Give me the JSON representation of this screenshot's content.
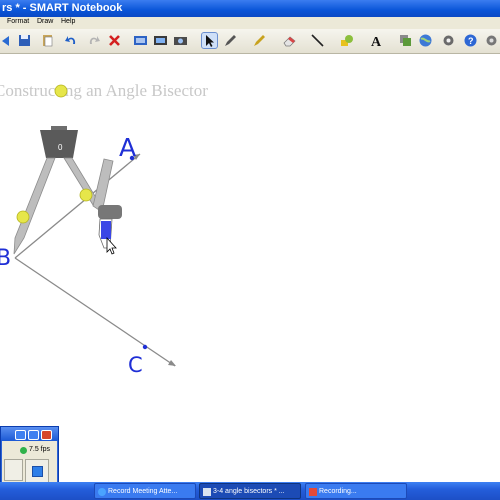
{
  "window": {
    "title": "rs * - SMART Notebook"
  },
  "menu": {
    "items": [
      "Format",
      "Draw",
      "Help"
    ]
  },
  "canvas": {
    "title": "Constructing an Angle Bisector",
    "points": {
      "a": "A",
      "b": "B",
      "c": "C"
    }
  },
  "recorder": {
    "fps": "7.5 fps"
  },
  "taskbar": {
    "items": [
      "Record Meeting Atte...",
      "3-4 angle bisectors * ...",
      "Recording..."
    ]
  },
  "colors": {
    "titlebar": "#0a55d8",
    "ink": "#1f2fd6",
    "compass_marker": "#e6e64a"
  }
}
